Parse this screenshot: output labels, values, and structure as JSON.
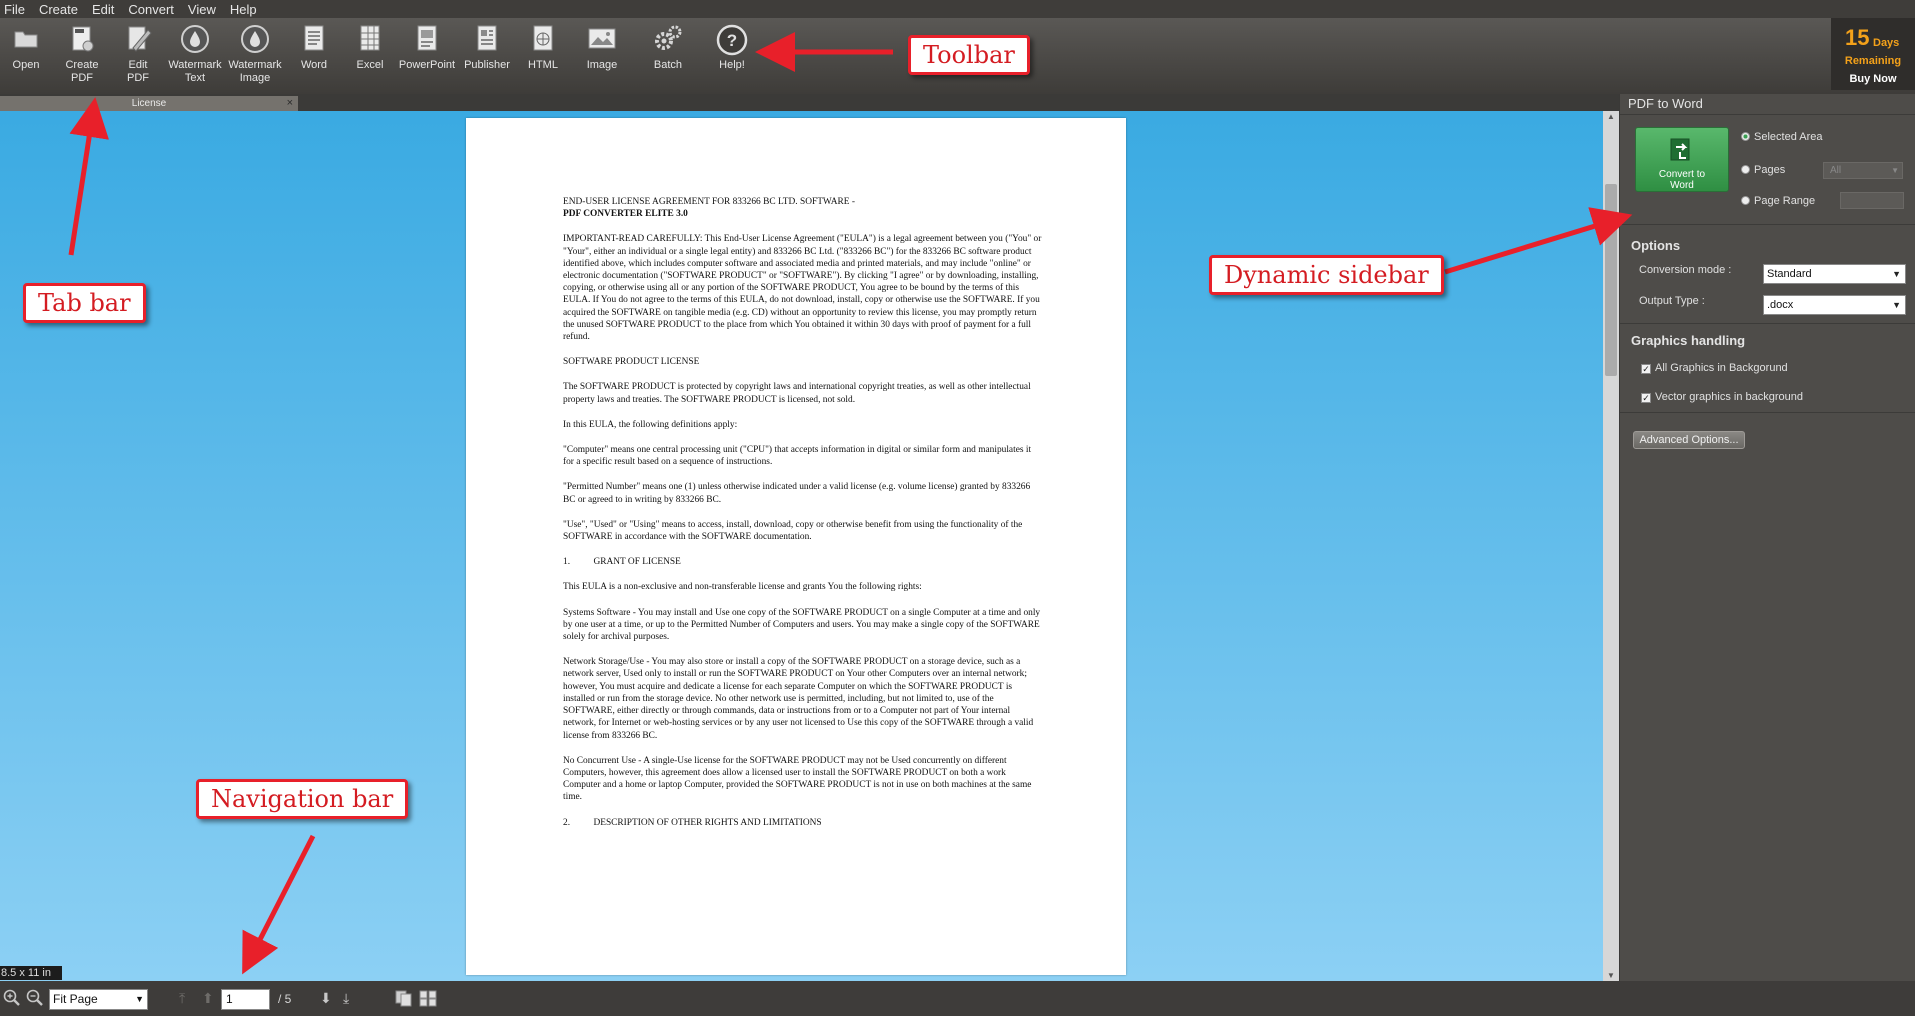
{
  "menu": [
    "File",
    "Create",
    "Edit",
    "Convert",
    "View",
    "Help"
  ],
  "toolbar": {
    "buttons": [
      {
        "line1": "Open",
        "line2": "",
        "icon": "folder-icon"
      },
      {
        "line1": "Create",
        "line2": "PDF",
        "icon": "create-pdf-icon"
      },
      {
        "line1": "Edit",
        "line2": "PDF",
        "icon": "edit-pdf-icon"
      },
      {
        "line1": "Watermark",
        "line2": "Text",
        "icon": "watermark-drop-icon"
      },
      {
        "line1": "Watermark",
        "line2": "Image",
        "icon": "watermark-drop-icon"
      },
      {
        "line1": "Word",
        "line2": "",
        "icon": "word-document-icon"
      },
      {
        "line1": "Excel",
        "line2": "",
        "icon": "excel-sheet-icon"
      },
      {
        "line1": "PowerPoint",
        "line2": "",
        "icon": "powerpoint-slides-icon"
      },
      {
        "line1": "Publisher",
        "line2": "",
        "icon": "publisher-document-icon"
      },
      {
        "line1": "HTML",
        "line2": "",
        "icon": "html-globe-icon"
      },
      {
        "line1": "Image",
        "line2": "",
        "icon": "image-picture-icon"
      },
      {
        "line1": "Batch",
        "line2": "",
        "icon": "batch-gears-icon"
      },
      {
        "line1": "Help!",
        "line2": "",
        "icon": "help-question-icon"
      }
    ]
  },
  "trial": {
    "days_number": "15",
    "days_label": "Days",
    "remaining": "Remaining",
    "buy": "Buy Now"
  },
  "tabs": [
    {
      "label": "License",
      "close": "×"
    }
  ],
  "document": {
    "title_line1": "END-USER  LICENSE  AGREEMENT  FOR  833266  BC  LTD.  SOFTWARE  -",
    "title_line2": "PDF CONVERTER ELITE 3.0",
    "paragraphs": [
      "IMPORTANT-READ CAREFULLY: This End-User License Agreement (\"EULA\") is a legal agreement between you (\"You\" or \"Your\", either an individual or a single legal entity) and 833266 BC Ltd. (\"833266 BC\") for the 833266 BC software product identified above, which includes computer software and associated media and printed materials, and may include \"online\" or electronic documentation (\"SOFTWARE PRODUCT\" or \"SOFTWARE\"). By clicking \"I agree\" or by downloading, installing, copying, or otherwise using all or any portion of the SOFTWARE PRODUCT, You agree to be bound by the terms of this EULA. If You do not agree to the terms of this EULA, do not download, install, copy or otherwise use the SOFTWARE. If you acquired the SOFTWARE on tangible media (e.g. CD) without an opportunity to review this license, you may promptly return the unused SOFTWARE PRODUCT to the place from which You obtained it within 30 days with proof of payment for a full refund.",
      "SOFTWARE PRODUCT LICENSE",
      "The SOFTWARE PRODUCT is protected by copyright laws and international copyright treaties, as well as other intellectual property laws and treaties. The SOFTWARE PRODUCT is licensed, not sold.",
      "In this EULA, the following definitions apply:",
      "\"Computer\" means one central processing unit (\"CPU\") that accepts information in digital or similar form and manipulates it for a specific result based on a sequence of instructions.",
      "\"Permitted Number\" means one (1) unless otherwise indicated under a valid license (e.g. volume license) granted by 833266 BC or agreed to in writing by 833266 BC.",
      "\"Use\", \"Used\" or \"Using\" means to access, install, download, copy or otherwise benefit from using the functionality of the SOFTWARE in accordance with the SOFTWARE documentation.",
      "1.          GRANT OF LICENSE",
      "This EULA is a non-exclusive and non-transferable license and grants You the following rights:",
      "Systems Software - You may install and Use one copy of the SOFTWARE PRODUCT on a single Computer at a time and only by one user at a time, or up to the Permitted Number of Computers and users. You may make a single copy of the SOFTWARE solely for archival purposes.",
      "Network Storage/Use - You may also store or install a copy of the SOFTWARE PRODUCT on a storage device, such as a network server, Used only to install or run the SOFTWARE PRODUCT on Your other Computers over an internal network; however, You must acquire and dedicate a license for each separate Computer on which the SOFTWARE PRODUCT is installed or run from the storage device. No other network use is permitted, including, but not limited to, use of the SOFTWARE, either directly or through commands, data or instructions from or to a Computer not part of Your internal network, for Internet or web-hosting services or by any user not licensed to Use this copy of the SOFTWARE through a valid license from 833266 BC.",
      "No Concurrent Use - A single-Use license for the SOFTWARE PRODUCT may not be Used concurrently on different Computers, however, this agreement does allow a licensed user to install the SOFTWARE PRODUCT on both a work Computer and a home or laptop Computer, provided the SOFTWARE PRODUCT is not in use on both machines at the same time.",
      "2.          DESCRIPTION OF OTHER RIGHTS AND LIMITATIONS"
    ]
  },
  "page_size_label": "8.5 x 11 in",
  "nav": {
    "zoom_mode": "Fit Page",
    "current_page": "1",
    "total_pages": "/ 5"
  },
  "sidebar": {
    "title": "PDF to Word",
    "convert_button": {
      "line1": "Convert to",
      "line2": "Word"
    },
    "radios": [
      {
        "label": "Selected Area",
        "checked": true
      },
      {
        "label": "Pages",
        "checked": false
      },
      {
        "label": "Page Range",
        "checked": false
      }
    ],
    "pages_select": "All",
    "options_heading": "Options",
    "conversion_mode_label": "Conversion mode :",
    "conversion_mode_value": "Standard",
    "output_type_label": "Output Type :",
    "output_type_value": ".docx",
    "graphics_heading": "Graphics handling",
    "checkboxes": [
      {
        "label": "All Graphics in Backgorund",
        "checked": true
      },
      {
        "label": "Vector graphics in background",
        "checked": true
      }
    ],
    "advanced_button": "Advanced Options..."
  },
  "annotations": {
    "toolbar": "Toolbar",
    "tab_bar": "Tab bar",
    "dynamic_sidebar": "Dynamic sidebar",
    "navigation_bar": "Navigation bar"
  },
  "colors": {
    "accent_green": "#3a9f52",
    "trial_orange": "#f3a11a",
    "callout_red": "#e8202a",
    "viewer_blue": "#3aaae2"
  }
}
